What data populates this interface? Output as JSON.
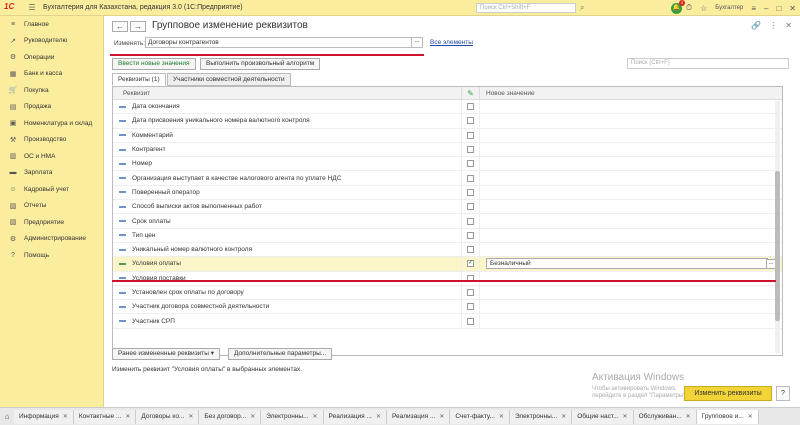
{
  "titlebar": {
    "logo": "1С",
    "app_title": "Бухгалтерия для Казахстана, редакция 3.0  (1С:Предприятие)",
    "search_placeholder": "Поиск Ctrl+Shift+F",
    "notification_count": "3",
    "user": "Бухгалтер"
  },
  "sidebar": {
    "items": [
      {
        "icon": "menu-icon",
        "label": "Главное"
      },
      {
        "icon": "chart-icon",
        "label": "Руководителю"
      },
      {
        "icon": "operations-icon",
        "label": "Операции"
      },
      {
        "icon": "bank-icon",
        "label": "Банк и касса"
      },
      {
        "icon": "cart-icon",
        "label": "Покупка"
      },
      {
        "icon": "sale-icon",
        "label": "Продажа"
      },
      {
        "icon": "warehouse-icon",
        "label": "Номенклатура и склад"
      },
      {
        "icon": "factory-icon",
        "label": "Производство"
      },
      {
        "icon": "assets-icon",
        "label": "ОС и НМА"
      },
      {
        "icon": "salary-icon",
        "label": "Зарплата"
      },
      {
        "icon": "people-icon",
        "label": "Кадровый учет"
      },
      {
        "icon": "reports-icon",
        "label": "Отчеты"
      },
      {
        "icon": "enterprise-icon",
        "label": "Предприятие"
      },
      {
        "icon": "admin-icon",
        "label": "Администрирование"
      },
      {
        "icon": "help-icon",
        "label": "Помощь"
      }
    ]
  },
  "form": {
    "title": "Групповое изменение реквизитов",
    "change_label": "Изменять:",
    "change_value": "Договоры контрагентов",
    "all_elements_link": "Все элементы",
    "btn_new_values": "Ввести новые значения",
    "btn_custom_algorithm": "Выполнить произвольный алгоритм",
    "search_placeholder": "Поиск (Ctrl+F)",
    "tab_attributes": "Реквизиты (1)",
    "tab_participants": "Участники совместной деятельности",
    "col_attribute": "Реквизит",
    "col_new_value": "Новое значение",
    "rows": [
      {
        "label": "Дата окончания",
        "checked": false,
        "value": ""
      },
      {
        "label": "Дата присвоения уникального номера валютного контроля",
        "checked": false,
        "value": ""
      },
      {
        "label": "Комментарий",
        "checked": false,
        "value": ""
      },
      {
        "label": "Контрагент",
        "checked": false,
        "value": ""
      },
      {
        "label": "Номер",
        "checked": false,
        "value": ""
      },
      {
        "label": "Организация выступает в качестве налогового агента по уплате НДС",
        "checked": false,
        "value": ""
      },
      {
        "label": "Поверенный оператор",
        "checked": false,
        "value": ""
      },
      {
        "label": "Способ выписки актов выполненных работ",
        "checked": false,
        "value": ""
      },
      {
        "label": "Срок оплаты",
        "checked": false,
        "value": ""
      },
      {
        "label": "Тип цен",
        "checked": false,
        "value": ""
      },
      {
        "label": "Уникальный номер валютного контроля",
        "checked": false,
        "value": ""
      },
      {
        "label": "Условия оплаты",
        "checked": true,
        "value": "Безналичный"
      },
      {
        "label": "Условия поставки",
        "checked": false,
        "value": ""
      },
      {
        "label": "Установлен срок оплаты по договору",
        "checked": false,
        "value": ""
      },
      {
        "label": "Участник договора совместной деятельности",
        "checked": false,
        "value": ""
      },
      {
        "label": "Участник СРП",
        "checked": false,
        "value": ""
      }
    ],
    "btn_previous": "Ранее измененные реквизиты",
    "btn_additional": "Дополнительные параметры...",
    "hint": "Изменить реквизит \"Условия оплаты\" в выбранных элементах.",
    "apply_button": "Изменить реквизиты",
    "help_button": "?"
  },
  "watermark": {
    "title": "Активация Windows",
    "text": "Чтобы активировать Windows, перейдите в раздел \"Параметры\"."
  },
  "bottom_tabs": [
    "Информация",
    "Контактные ...",
    "Договоры ко...",
    "Без договор...",
    "Электронны...",
    "Реализация ...",
    "Реализация ...",
    "Счет-факту...",
    "Электронны...",
    "Общие наст...",
    "Обслуживан...",
    "Групповое и..."
  ]
}
